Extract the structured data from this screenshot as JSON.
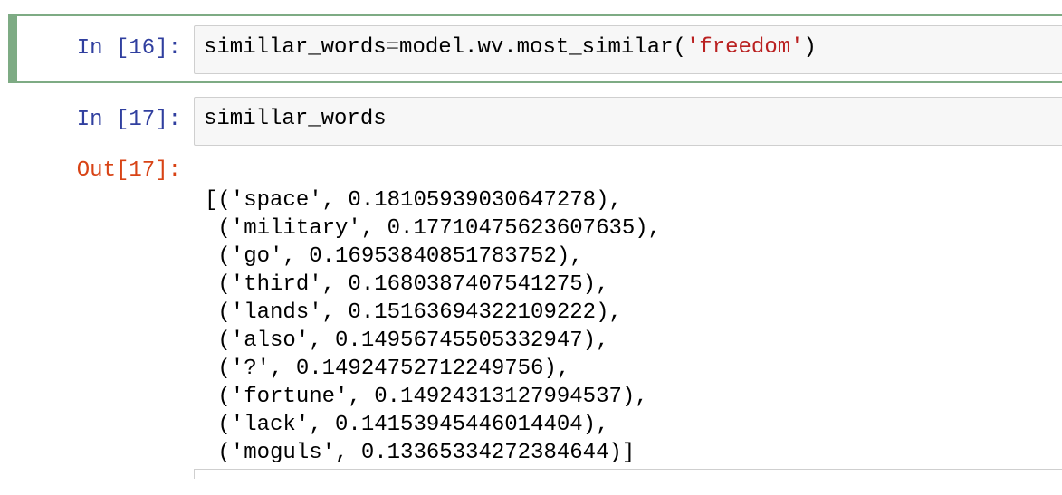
{
  "cells": [
    {
      "prompt": "In [16]:",
      "code_var": "simillar_words",
      "code_op": "=",
      "code_call": "model.wv.most_similar(",
      "code_str": "'freedom'",
      "code_end": ")"
    },
    {
      "prompt": "In [17]:",
      "code": "simillar_words",
      "out_prompt": "Out[17]:",
      "output_lines": [
        "[('space', 0.18105939030647278),",
        " ('military', 0.17710475623607635),",
        " ('go', 0.16953840851783752),",
        " ('third', 0.1680387407541275),",
        " ('lands', 0.15163694322109222),",
        " ('also', 0.14956745505332947),",
        " ('?', 0.14924752712249756),",
        " ('fortune', 0.14924313127994537),",
        " ('lack', 0.14153945446014404),",
        " ('moguls', 0.13365334272384644)]"
      ]
    }
  ]
}
